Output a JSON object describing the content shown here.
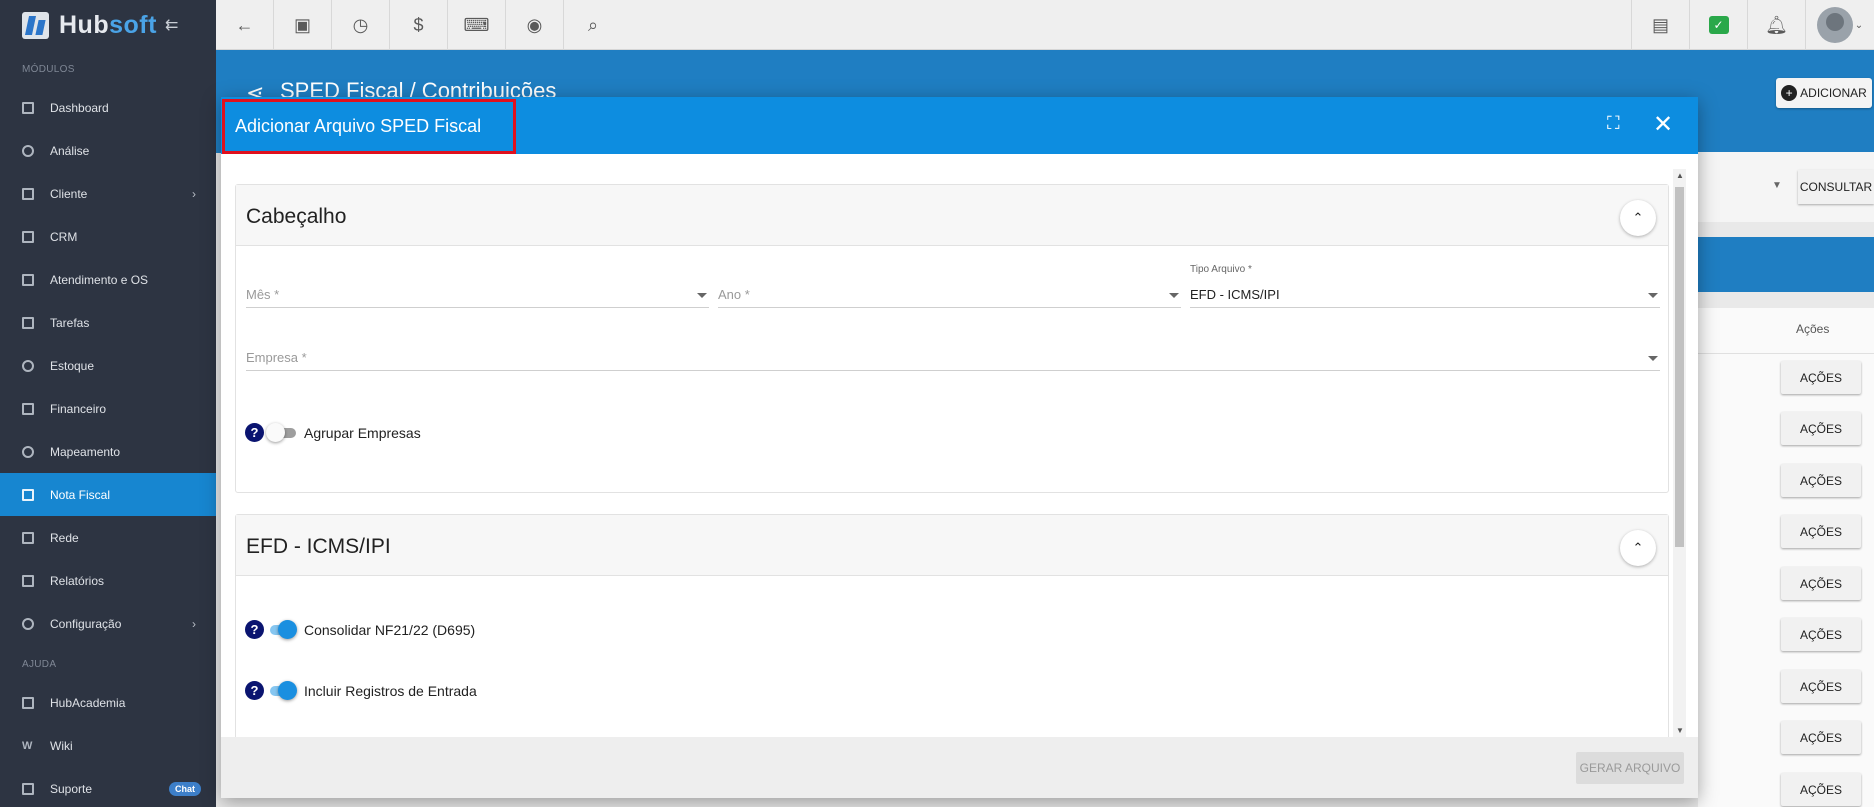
{
  "app": {
    "brand_hub": "Hub",
    "brand_soft": "soft"
  },
  "sidebar": {
    "section_modulos": "MÓDULOS",
    "section_ajuda": "AJUDA",
    "items": [
      {
        "label": "Dashboard"
      },
      {
        "label": "Análise"
      },
      {
        "label": "Cliente"
      },
      {
        "label": "CRM"
      },
      {
        "label": "Atendimento e OS"
      },
      {
        "label": "Tarefas"
      },
      {
        "label": "Estoque"
      },
      {
        "label": "Financeiro"
      },
      {
        "label": "Mapeamento"
      },
      {
        "label": "Nota Fiscal"
      },
      {
        "label": "Rede"
      },
      {
        "label": "Relatórios"
      },
      {
        "label": "Configuração"
      }
    ],
    "help_items": [
      {
        "label": "HubAcademia"
      },
      {
        "label": "Wiki"
      },
      {
        "label": "Suporte",
        "badge": "Chat"
      }
    ]
  },
  "page": {
    "title": "SPED Fiscal / Contribuições",
    "add_label": "ADICIONAR",
    "consultar_label": "CONSULTAR",
    "acoes_header": "Ações",
    "acoes_button": "AÇÕES"
  },
  "modal": {
    "title": "Adicionar Arquivo SPED Fiscal",
    "header_section": {
      "title": "Cabeçalho",
      "mes_label": "Mês *",
      "ano_label": "Ano *",
      "tipo_label": "Tipo Arquivo *",
      "tipo_value": "EFD - ICMS/IPI",
      "empresa_label": "Empresa *",
      "agrupar_label": "Agrupar Empresas",
      "agrupar_on": false
    },
    "efd_section": {
      "title": "EFD - ICMS/IPI",
      "consolidar_label": "Consolidar NF21/22 (D695)",
      "consolidar_on": true,
      "incluir_label": "Incluir Registros de Entrada",
      "incluir_on": true
    },
    "gerar_label": "GERAR ARQUIVO"
  },
  "colors": {
    "sidebar_bg": "#2d3442",
    "active": "#1786d0",
    "modal_header": "#0d8de0",
    "highlight": "#e0101e"
  }
}
